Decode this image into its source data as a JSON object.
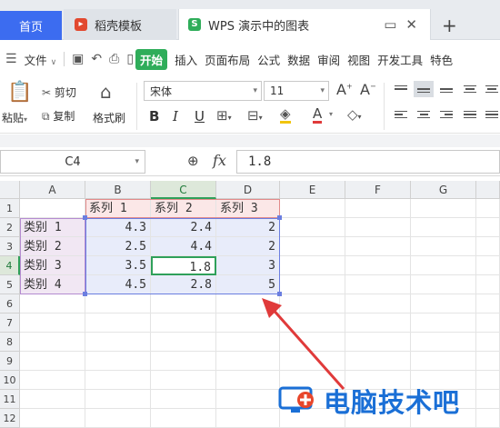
{
  "tabs": {
    "home": "首页",
    "template": "稻壳模板",
    "document": "WPS 演示中的图表",
    "add": "+"
  },
  "menu": {
    "file": "文件",
    "items": [
      "开始",
      "插入",
      "页面布局",
      "公式",
      "数据",
      "审阅",
      "视图",
      "开发工具",
      "特色"
    ],
    "active": "开始"
  },
  "ribbon": {
    "paste": "粘贴",
    "cut": "剪切",
    "copy": "复制",
    "format_painter": "格式刷",
    "font_name": "宋体",
    "font_size": "11",
    "bold": "B",
    "italic": "I",
    "underline": "U",
    "font_color_letter": "A"
  },
  "formula_bar": {
    "name_box": "C4",
    "fx": "fx",
    "value": "1.8"
  },
  "sheet": {
    "columns": [
      "A",
      "B",
      "C",
      "D",
      "E",
      "F",
      "G"
    ],
    "rows": [
      "1",
      "2",
      "3",
      "4",
      "5",
      "6",
      "7",
      "8",
      "9",
      "10",
      "11",
      "12"
    ],
    "series_headers": [
      "系列 1",
      "系列 2",
      "系列 3"
    ],
    "categories": [
      "类别 1",
      "类别 2",
      "类别 3",
      "类别 4"
    ],
    "values": [
      [
        "4.3",
        "2.4",
        "2"
      ],
      [
        "2.5",
        "4.4",
        "2"
      ],
      [
        "3.5",
        "1.8",
        "3"
      ],
      [
        "4.5",
        "2.8",
        "5"
      ]
    ],
    "selected_cell": "C4"
  },
  "watermark": "电脑技术吧",
  "colors": {
    "accent_green": "#2fad5a",
    "home_tab_blue": "#3c6cf0",
    "arrow_red": "#e03a3a",
    "watermark_blue": "#1a6fd6"
  }
}
